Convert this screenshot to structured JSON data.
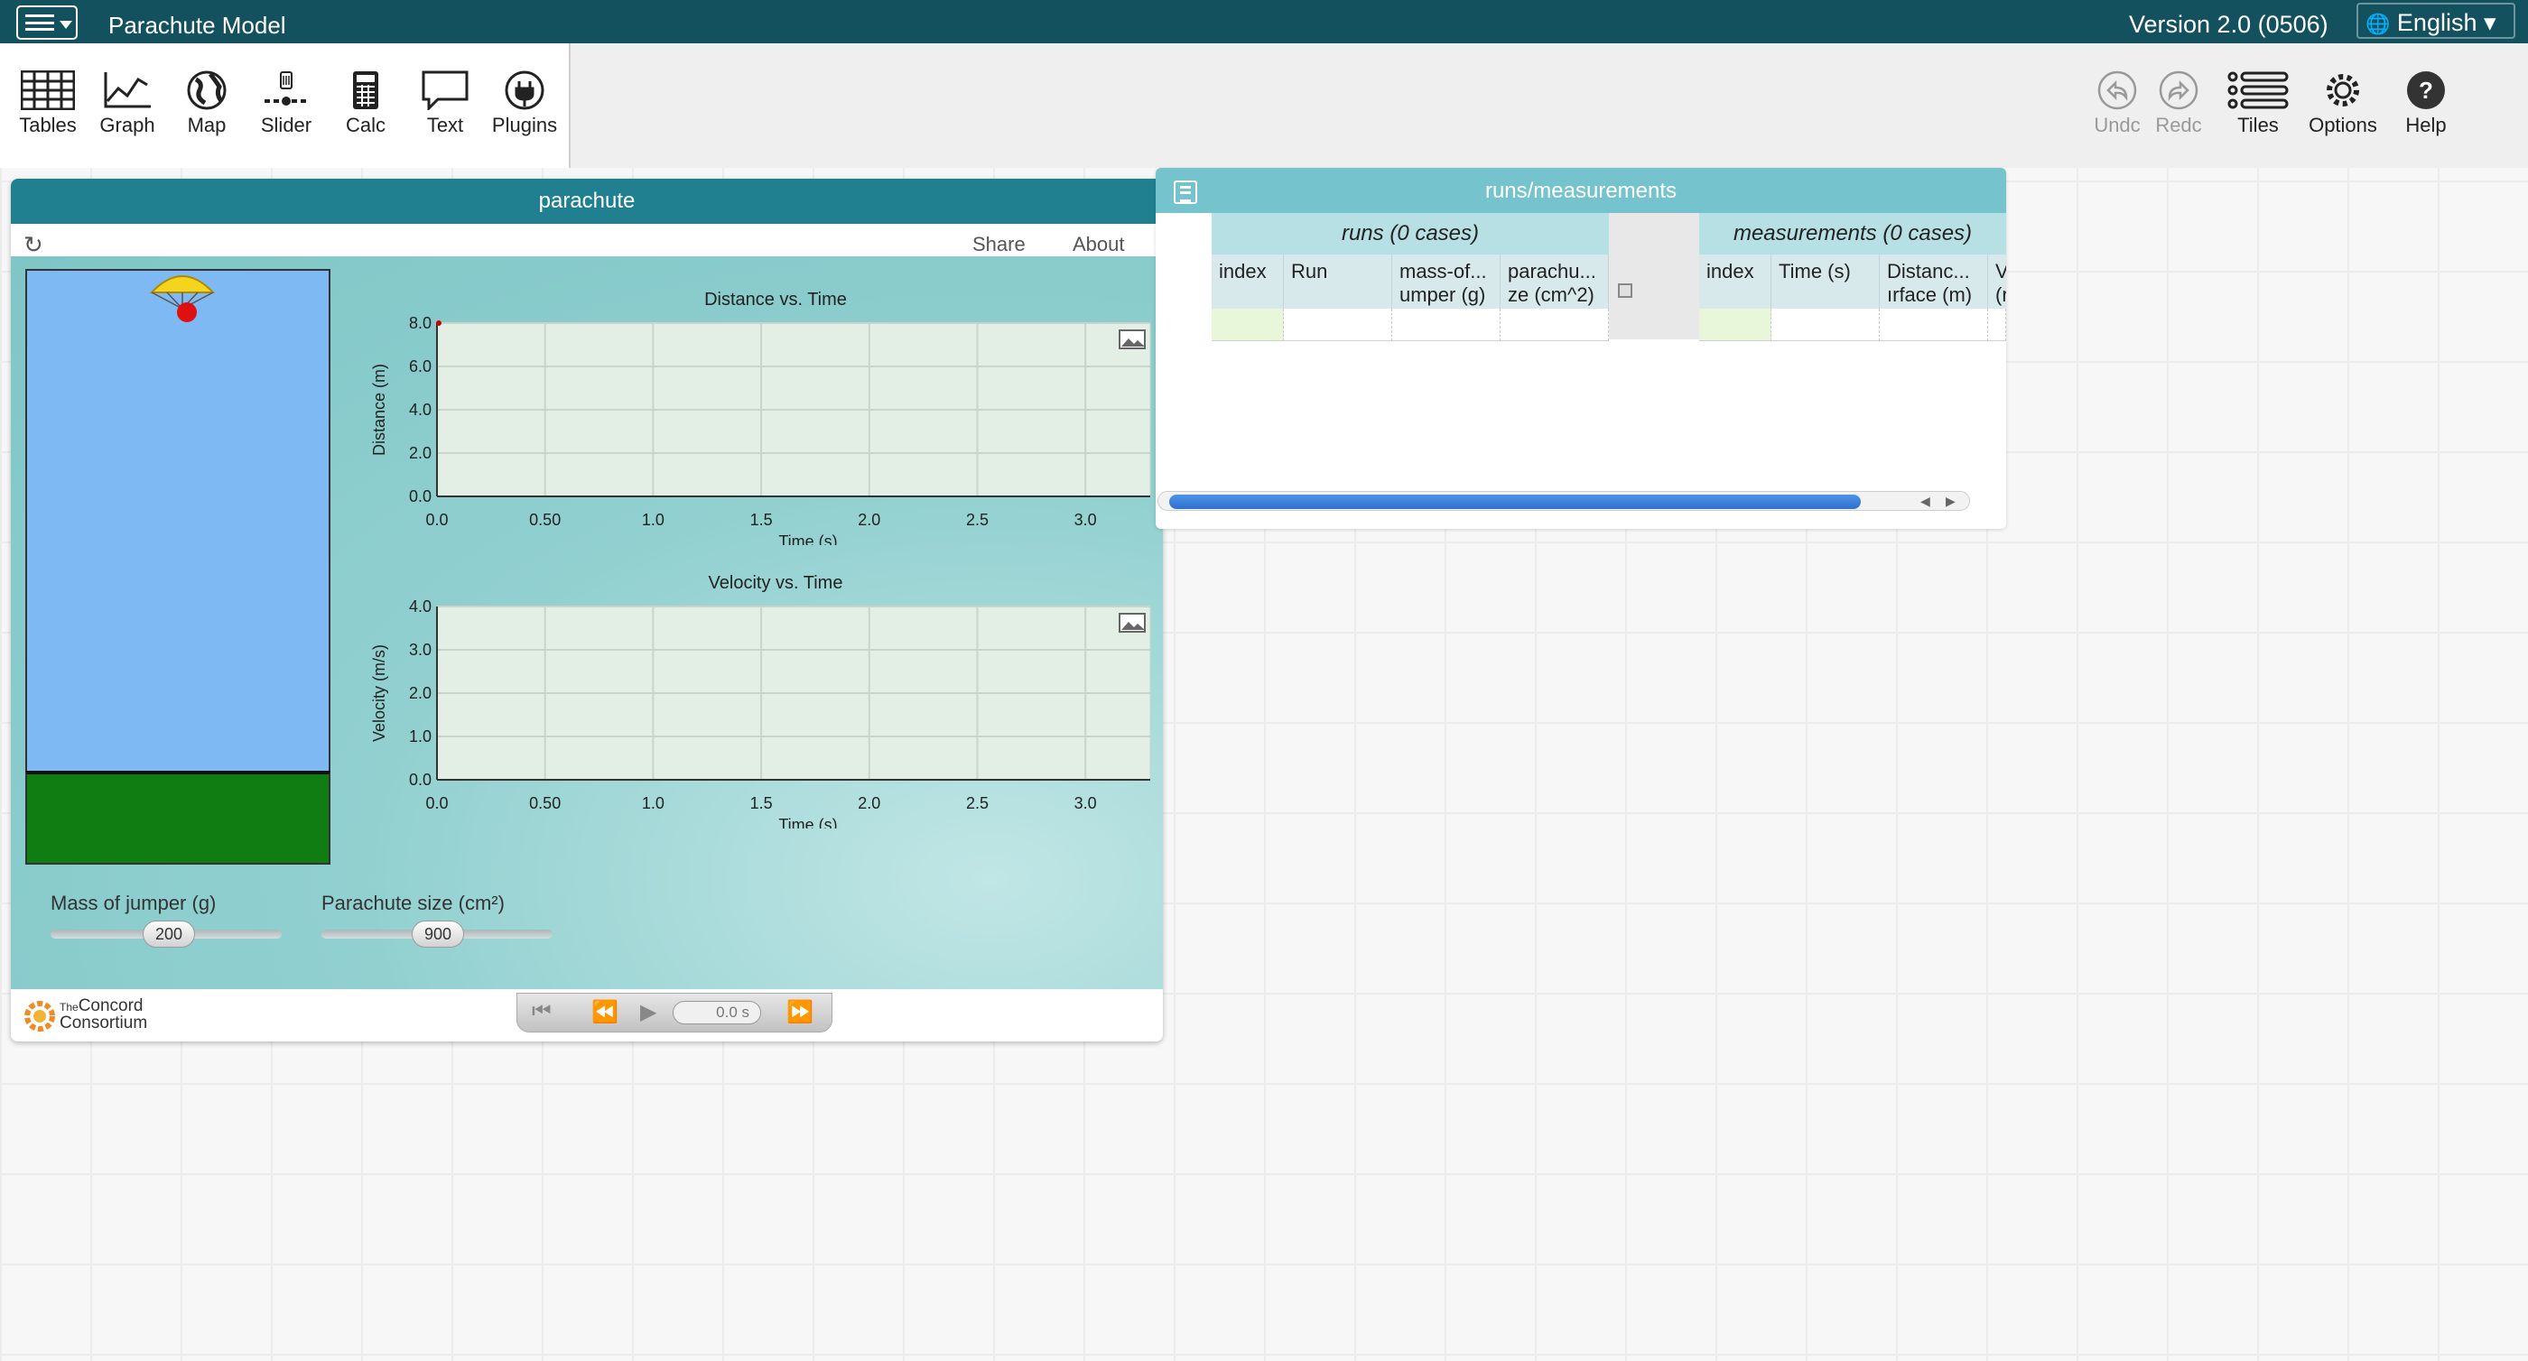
{
  "topbar": {
    "doc_title": "Parachute Model",
    "version": "Version 2.0 (0506)",
    "language": "English ▾",
    "globe": "🌐"
  },
  "toolshelf": {
    "tools": [
      "Tables",
      "Graph",
      "Map",
      "Slider",
      "Calc",
      "Text",
      "Plugins"
    ]
  },
  "rightshelf": {
    "undo": "Undc",
    "redo": "Redc",
    "tiles": "Tiles",
    "options": "Options",
    "help": "Help"
  },
  "sim": {
    "title": "parachute",
    "reload": "↻",
    "share": "Share",
    "about": "About",
    "slider_mass": {
      "label": "Mass of jumper (g)",
      "value": "200"
    },
    "slider_size": {
      "label": "Parachute size (cm²)",
      "value": "900"
    },
    "logo": {
      "line1": "The",
      "line2": "Concord",
      "line3": "Consortium"
    },
    "player": {
      "time": "0.0 s",
      "btn_start": "⏮",
      "btn_back": "⏪",
      "btn_play": "▶",
      "btn_fwd": "⏩"
    }
  },
  "chart_data": [
    {
      "type": "line",
      "title": "Distance vs. Time",
      "xlabel": "Time (s)",
      "ylabel": "Distance (m)",
      "xlim": [
        0,
        3.3
      ],
      "ylim": [
        0,
        8.0
      ],
      "x_ticks": [
        "0.0",
        "0.50",
        "1.0",
        "1.5",
        "2.0",
        "2.5",
        "3.0"
      ],
      "y_ticks": [
        "0.0",
        "2.0",
        "4.0",
        "6.0",
        "8.0"
      ],
      "series": [
        {
          "x": [
            0.0
          ],
          "y": [
            8.0
          ],
          "color": "#cc0000"
        }
      ],
      "grid": true
    },
    {
      "type": "line",
      "title": "Velocity vs. Time",
      "xlabel": "Time (s)",
      "ylabel": "Velocity (m/s)",
      "xlim": [
        0,
        3.3
      ],
      "ylim": [
        0,
        4.0
      ],
      "x_ticks": [
        "0.0",
        "0.50",
        "1.0",
        "1.5",
        "2.0",
        "2.5",
        "3.0"
      ],
      "y_ticks": [
        "0.0",
        "1.0",
        "2.0",
        "3.0",
        "4.0"
      ],
      "series": [],
      "grid": true
    }
  ],
  "table": {
    "title": "runs/measurements",
    "runs": {
      "group": "runs (0 cases)",
      "columns": [
        "index",
        "Run",
        "mass-of...\numper (g)",
        "parachu...\nze (cm^2)"
      ]
    },
    "measurements": {
      "group": "measurements (0 cases)",
      "columns": [
        "index",
        "Time (s)",
        "Distanc...\nırface (m)",
        "V\n(r"
      ]
    }
  }
}
